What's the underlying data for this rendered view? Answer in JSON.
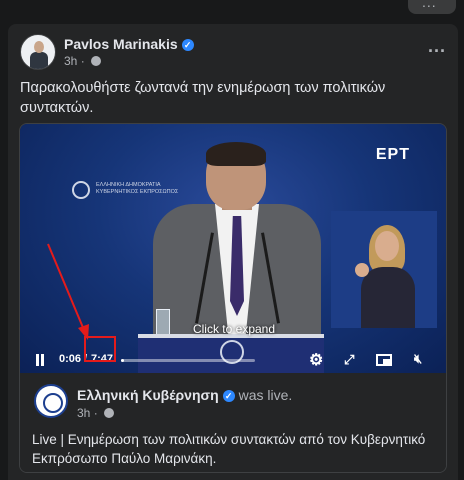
{
  "window": {
    "more_label": "..."
  },
  "post": {
    "author": "Pavlos Marinakis",
    "time": "3h",
    "more_label": "...",
    "caption": "Παρακολουθήστε ζωντανά την ενημέρωση των πολιτικών συντακτών."
  },
  "video": {
    "channel_logo": "ΕΡΤ",
    "backdrop_text": "ΕΛΛΗΝΙΚΗ ΔΗΜΟΚΡΑΤΙΑ\nΚΥΒΕΡΝΗΤΙΚΟΣ ΕΚΠΡΟΣΩΠΟΣ",
    "overlay_text": "Click to expand",
    "current_time": "0:06",
    "separator": "/",
    "duration": "7:47",
    "progress_fraction": 0.013,
    "controls": [
      "pause-icon",
      "settings-gear-icon",
      "fullscreen-expand-icon",
      "picture-in-picture-icon",
      "mute-icon"
    ]
  },
  "shared": {
    "page_name": "Ελληνική Κυβέρνηση",
    "status": "was live.",
    "time": "3h",
    "description": "Live | Ενημέρωση των πολιτικών συντακτών από τον Κυβερνητικό Εκπρόσωπο Παύλο Μαρινάκη."
  },
  "colors": {
    "background": "#18191a",
    "card": "#242526",
    "text": "#e4e6eb",
    "secondary_text": "#b0b3b8",
    "verified": "#2d88ff",
    "annotation_red": "#e41b1b"
  }
}
